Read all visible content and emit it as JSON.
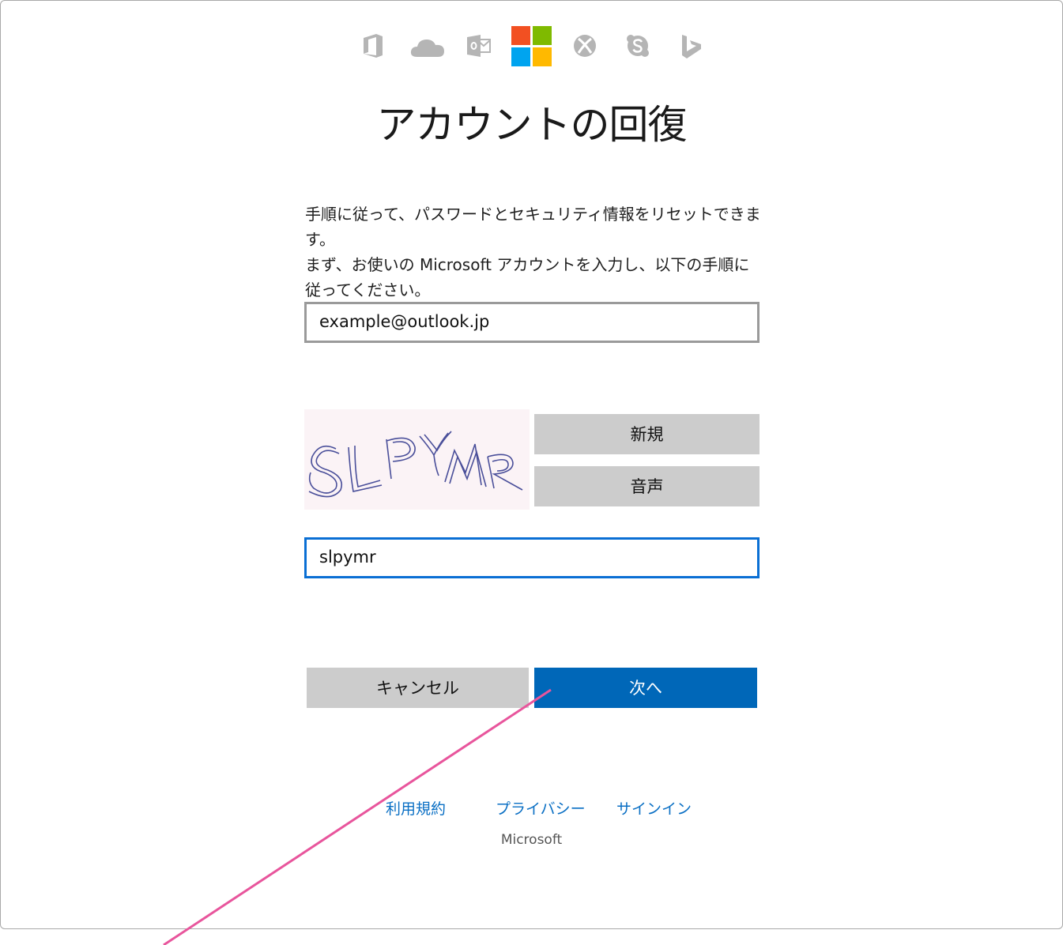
{
  "header": {
    "brand_icons": [
      "office-icon",
      "onedrive-icon",
      "outlook-icon",
      "microsoft-logo",
      "xbox-icon",
      "skype-icon",
      "bing-icon"
    ],
    "title": "アカウントの回復"
  },
  "instructions": "手順に従って、パスワードとセキュリティ情報をリセットできます。\nまず、お使いの Microsoft アカウントを入力し、以下の手順に\n従ってください。",
  "form": {
    "email_value": "example@outlook.jp",
    "captcha_image_text": "SLPYMR",
    "new_label": "新規",
    "audio_label": "音声",
    "captcha_value": "slpymr",
    "cancel_label": "キャンセル",
    "next_label": "次へ"
  },
  "footer": {
    "terms": "利用規約",
    "privacy": "プライバシー",
    "signin": "サインイン",
    "copyright": "Microsoft"
  },
  "colors": {
    "accent": "#0067b8",
    "focus_border": "#0a6fd4",
    "link": "#0a6fc4",
    "secondary_button": "#cccccc",
    "annotation_line": "#e8559c"
  }
}
